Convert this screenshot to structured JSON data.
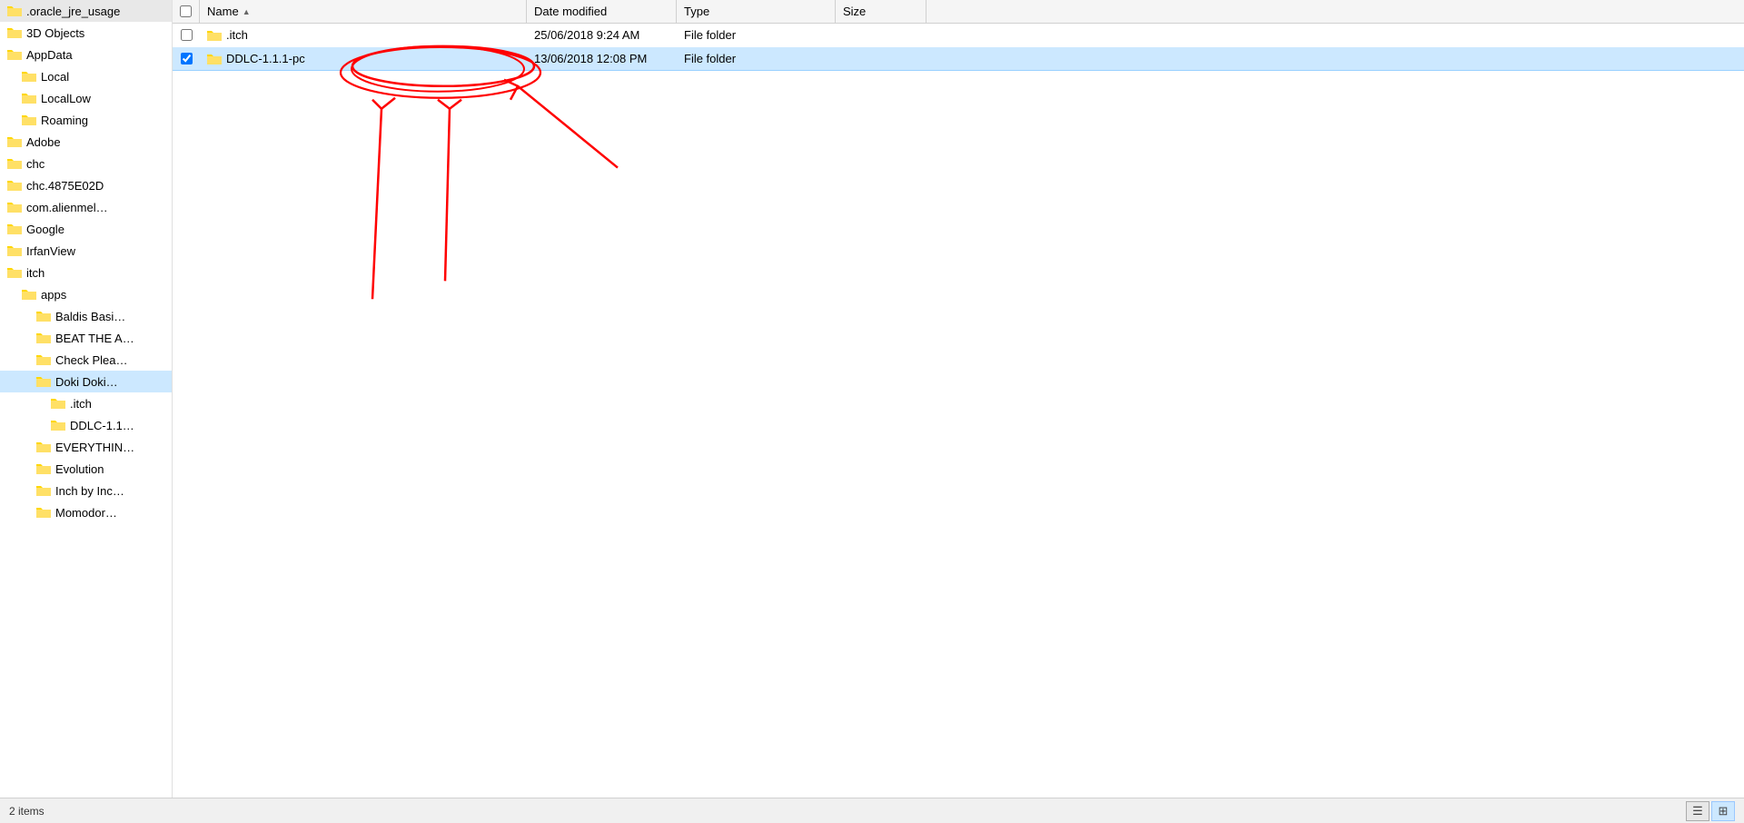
{
  "sidebar": {
    "items": [
      {
        "id": "oracle_jre_usage",
        "label": ".oracle_jre_usage",
        "indent": 0,
        "selected": false
      },
      {
        "id": "3d_objects",
        "label": "3D Objects",
        "indent": 0,
        "selected": false
      },
      {
        "id": "appdata",
        "label": "AppData",
        "indent": 0,
        "selected": false
      },
      {
        "id": "local",
        "label": "Local",
        "indent": 1,
        "selected": false
      },
      {
        "id": "locallow",
        "label": "LocalLow",
        "indent": 1,
        "selected": false
      },
      {
        "id": "roaming",
        "label": "Roaming",
        "indent": 1,
        "selected": false
      },
      {
        "id": "adobe",
        "label": "Adobe",
        "indent": 0,
        "selected": false
      },
      {
        "id": "chc",
        "label": "chc",
        "indent": 0,
        "selected": false
      },
      {
        "id": "chc4875",
        "label": "chc.4875E02D",
        "indent": 0,
        "selected": false
      },
      {
        "id": "com_alien",
        "label": "com.alienmel…",
        "indent": 0,
        "selected": false
      },
      {
        "id": "google",
        "label": "Google",
        "indent": 0,
        "selected": false
      },
      {
        "id": "irfanview",
        "label": "IrfanView",
        "indent": 0,
        "selected": false
      },
      {
        "id": "itch",
        "label": "itch",
        "indent": 0,
        "selected": false
      },
      {
        "id": "apps",
        "label": "apps",
        "indent": 1,
        "selected": false
      },
      {
        "id": "baldis_basi",
        "label": "Baldis Basi…",
        "indent": 2,
        "selected": false
      },
      {
        "id": "beat_the",
        "label": "BEAT THE A…",
        "indent": 2,
        "selected": false
      },
      {
        "id": "check_plea",
        "label": "Check Plea…",
        "indent": 2,
        "selected": false
      },
      {
        "id": "doki_doki",
        "label": "Doki Doki…",
        "indent": 2,
        "selected": true
      },
      {
        "id": "dot_itch",
        "label": ".itch",
        "indent": 3,
        "selected": false
      },
      {
        "id": "ddlc_1",
        "label": "DDLC-1.1…",
        "indent": 3,
        "selected": false
      },
      {
        "id": "everything",
        "label": "EVERYTHIN…",
        "indent": 2,
        "selected": false
      },
      {
        "id": "evolution",
        "label": "Evolution",
        "indent": 2,
        "selected": false
      },
      {
        "id": "inch_by_inc",
        "label": "Inch by Inc…",
        "indent": 2,
        "selected": false
      },
      {
        "id": "momodor",
        "label": "Momodor…",
        "indent": 2,
        "selected": false
      }
    ]
  },
  "columns": {
    "name": "Name",
    "date_modified": "Date modified",
    "type": "Type",
    "size": "Size"
  },
  "files": [
    {
      "id": "dot_itch_folder",
      "name": ".itch",
      "date_modified": "25/06/2018 9:24 AM",
      "type": "File folder",
      "size": "",
      "selected": false
    },
    {
      "id": "ddlc_folder",
      "name": "DDLC-1.1.1-pc",
      "date_modified": "13/06/2018 12:08 PM",
      "type": "File folder",
      "size": "",
      "selected": true
    }
  ],
  "status_bar": {
    "item_count": "2 items",
    "view_details_label": "Details view",
    "view_large_label": "Large icons view"
  }
}
